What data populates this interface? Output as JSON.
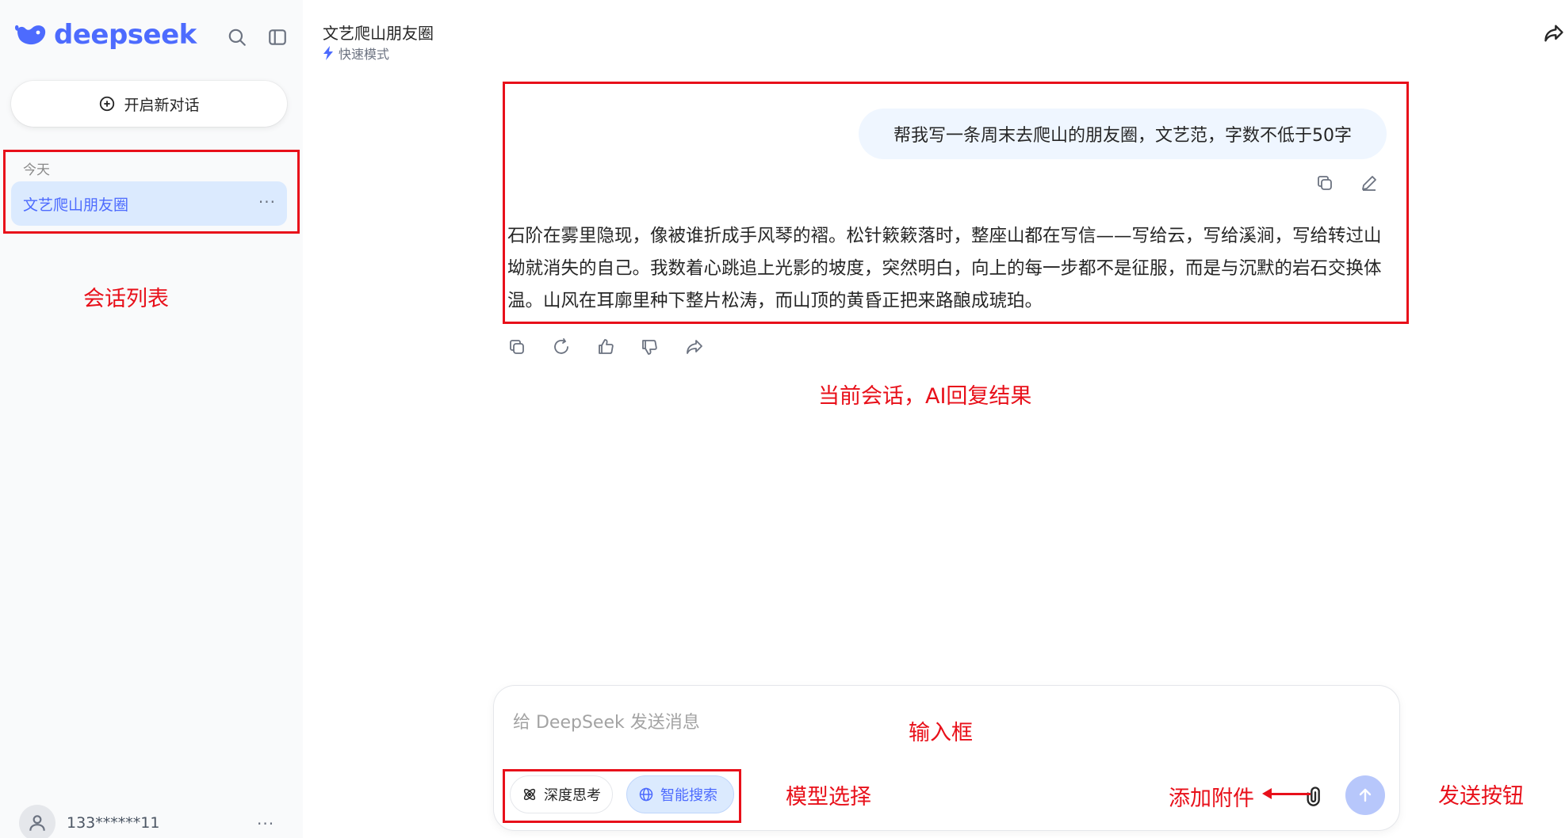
{
  "sidebar": {
    "logo_text": "deepseek",
    "new_chat_label": "开启新对话",
    "section_today": "今天",
    "conversations": [
      {
        "title": "文艺爬山朋友圈",
        "more": "···"
      }
    ],
    "user": {
      "name": "133******11",
      "more": "···"
    }
  },
  "header": {
    "title": "文艺爬山朋友圈",
    "mode": "快速模式"
  },
  "chat": {
    "user_message": "帮我写一条周末去爬山的朋友圈，文艺范，字数不低于50字",
    "ai_reply": "石阶在雾里隐现，像被谁折成手风琴的褶。松针簌簌落时，整座山都在写信——写给云，写给溪涧，写给转过山坳就消失的自己。我数着心跳追上光影的坡度，突然明白，向上的每一步都不是征服，而是与沉默的岩石交换体温。山风在耳廓里种下整片松涛，而山顶的黄昏正把来路酿成琥珀。"
  },
  "input": {
    "placeholder": "给 DeepSeek 发送消息",
    "deep_think_label": "深度思考",
    "smart_search_label": "智能搜索"
  },
  "annotations": {
    "conversation_list": "会话列表",
    "current_conversation": "当前会话，AI回复结果",
    "input_box": "输入框",
    "model_select": "模型选择",
    "add_attachment": "添加附件",
    "send_button": "发送按钮"
  },
  "colors": {
    "brand": "#4d6bfe",
    "annotation": "#e8101a",
    "selected_bg": "#dbeafe",
    "sidebar_bg": "#f9fafb"
  },
  "icons": {
    "logo": "whale-logo-icon",
    "search": "search-icon",
    "sidebar_toggle": "sidebar-toggle-icon",
    "new_chat": "plus-circle-icon",
    "mode": "lightning-icon",
    "share": "share-icon",
    "copy": "copy-icon",
    "edit": "edit-icon",
    "regenerate": "refresh-icon",
    "like": "thumbs-up-icon",
    "dislike": "thumbs-down-icon",
    "deep_think": "atom-icon",
    "smart_search": "globe-icon",
    "attach": "paperclip-icon",
    "send": "arrow-up-icon",
    "avatar": "user-icon"
  }
}
